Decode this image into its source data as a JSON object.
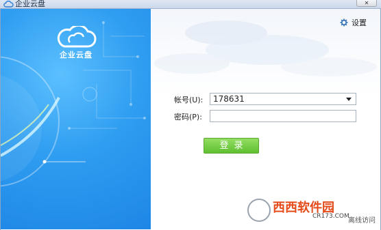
{
  "window": {
    "title": "企业云盘",
    "close_symbol": "✕"
  },
  "brand": {
    "name": "企业云盘"
  },
  "settings": {
    "label": "设置",
    "icon": "gear-icon"
  },
  "form": {
    "account_label": "帐号(U):",
    "account_value": "178631",
    "password_label": "密码(P):",
    "password_value": "",
    "login_label": "登录"
  },
  "watermark": {
    "text": "西西软件园",
    "url": "CR173.COM",
    "sub": "离线访问"
  },
  "colors": {
    "brand_blue": "#2f9df0",
    "login_green": "#6cc63d",
    "watermark_orange": "#e64a19"
  }
}
